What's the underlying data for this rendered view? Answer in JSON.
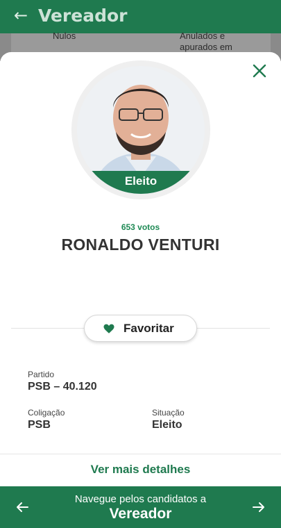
{
  "header": {
    "back_icon": "arrow-left-icon",
    "title": "Vereador"
  },
  "background_card": {
    "nulos": "Nulos",
    "anulados": "Anulados e apurados em"
  },
  "candidate": {
    "status_badge": "Eleito",
    "votes": "653 votos",
    "name": "RONALDO VENTURI"
  },
  "favorite": {
    "label": "Favoritar",
    "icon": "heart-icon"
  },
  "details": {
    "partido_label": "Partido",
    "partido_value": "PSB – 40.120",
    "coligacao_label": "Coligação",
    "coligacao_value": "PSB",
    "situacao_label": "Situação",
    "situacao_value": "Eleito"
  },
  "more_details_link": "Ver mais detalhes",
  "navigation": {
    "line1": "Navegue pelos candidatos a",
    "line2": "Vereador",
    "prev_icon": "arrow-left-icon",
    "next_icon": "arrow-right-icon"
  },
  "colors": {
    "brand_green": "#1f7a4f",
    "votes_green": "#1f8a55"
  }
}
